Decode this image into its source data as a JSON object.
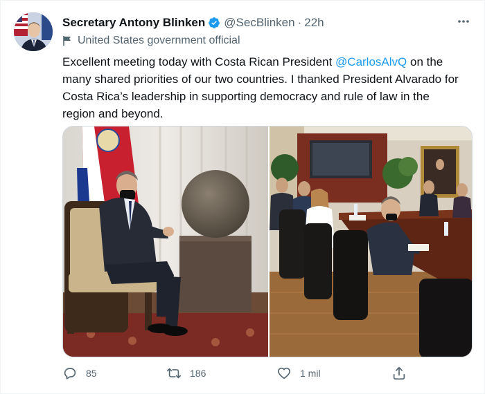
{
  "author": {
    "name": "Secretary Antony Blinken",
    "handle": "@SecBlinken",
    "separator": "·",
    "time": "22h",
    "label": "United States government official"
  },
  "tweet": {
    "text_before": "Excellent meeting today with Costa Rican President ",
    "mention": "@CarlosAlvQ",
    "text_after": " on the many shared priorities of our two countries. I thanked President Alvarado for Costa Rica’s leadership in supporting democracy and rule of law in the region and beyond."
  },
  "media": [
    {
      "name": "photo-meeting-seated"
    },
    {
      "name": "photo-meeting-table"
    }
  ],
  "actions": {
    "reply_count": "85",
    "retweet_count": "186",
    "like_count": "1 mil"
  },
  "colors": {
    "text": "#0f1419",
    "secondary": "#536471",
    "link": "#1d9bf0",
    "verified": "#1d9bf0"
  }
}
